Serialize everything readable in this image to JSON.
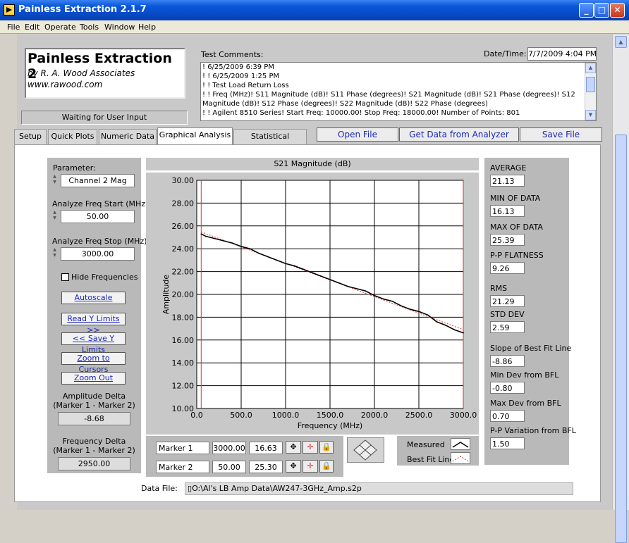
{
  "window": {
    "title": "Painless Extraction 2.1.7"
  },
  "menu": [
    "File",
    "Edit",
    "Operate",
    "Tools",
    "Window",
    "Help"
  ],
  "header": {
    "app_name": "Painless Extraction 2",
    "author": "by R. A. Wood Associates",
    "website": "www.rawood.com",
    "status": "Waiting for User Input"
  },
  "comments": {
    "label": "Test Comments:",
    "date_label": "Date/Time:",
    "date_value": "7/7/2009  4:04 PM",
    "lines": [
      "! 6/25/2009 6:39 PM",
      "! ! 6/25/2009 1:25 PM",
      "! ! Test Load Return Loss",
      "! ! Freq (MHz)! S11 Magnitude (dB)! S11 Phase (degrees)! S21 Magnitude (dB)! S21 Phase (degrees)! S12",
      "Magnitude (dB)! S12 Phase (degrees)! S22 Magnitude (dB)! S22 Phase (degrees)",
      "! ! Agilent 8510 Series! Start Freq: 10000.00! Stop Freq: 18000.00! Number of Points: 801"
    ]
  },
  "tabs": [
    "Setup",
    "Quick Plots",
    "Numeric Data",
    "Graphical Analysis",
    "Statistical Analysis"
  ],
  "actions": {
    "open": "Open File",
    "get_data": "Get Data from Analyzer",
    "save": "Save File"
  },
  "left": {
    "parameter_label": "Parameter:",
    "parameter_value": "Channel 2 Mag",
    "start_label": "Analyze Freq Start (MHz)",
    "start_value": "50.00",
    "stop_label": "Analyze Freq Stop (MHz)",
    "stop_value": "3000.00",
    "hide_freq": "Hide Frequencies",
    "autoscale": "Autoscale",
    "read_y": "Read Y Limits >>",
    "save_y": "<< Save Y Limits",
    "zoom_cursors": "Zoom to Cursors",
    "zoom_out": "Zoom Out",
    "amp_delta_label1": "Amplitude Delta",
    "amp_delta_label2": "(Marker 1 - Marker 2)",
    "amp_delta_value": "-8.68",
    "freq_delta_label1": "Frequency Delta",
    "freq_delta_label2": "(Marker 1 - Marker 2)",
    "freq_delta_value": "2950.00"
  },
  "stats": [
    {
      "label": "AVERAGE",
      "value": "21.13"
    },
    {
      "label": "MIN OF DATA",
      "value": "16.13"
    },
    {
      "label": "MAX OF DATA",
      "value": "25.39"
    },
    {
      "label": "P-P FLATNESS",
      "value": "9.26"
    },
    {
      "label": "RMS",
      "value": "21.29"
    },
    {
      "label": "STD DEV",
      "value": "2.59"
    },
    {
      "label": "Slope of Best Fit Line",
      "value": "-8.86"
    },
    {
      "label": "Min Dev from BFL",
      "value": "-0.80"
    },
    {
      "label": "Max Dev from BFL",
      "value": "0.70"
    },
    {
      "label": "P-P Variation from BFL",
      "value": "1.50"
    }
  ],
  "markers": [
    {
      "name": "Marker 1",
      "freq": "3000.00",
      "amp": "16.63"
    },
    {
      "name": "Marker 2",
      "freq": "50.00",
      "amp": "25.30"
    }
  ],
  "legend": {
    "measured": "Measured",
    "bfl": "Best Fit Line"
  },
  "datafile": {
    "label": "Data File:",
    "path": "O:\\Al's LB Amp Data\\AW247-3GHz_Amp.s2p"
  },
  "colors": {
    "accent": "#1b28b8",
    "cursor": "#e03030",
    "trace": "#000000"
  },
  "chart_data": {
    "type": "line",
    "title": "S21 Magnitude (dB)",
    "xlabel": "Frequency (MHz)",
    "ylabel": "Amplitude",
    "xlim": [
      0,
      3000
    ],
    "ylim": [
      10,
      30
    ],
    "grid": true,
    "x_ticks": [
      "0.0",
      "500.0",
      "1000.0",
      "1500.0",
      "2000.0",
      "2500.0",
      "3000.0"
    ],
    "y_ticks": [
      "10.00",
      "12.00",
      "14.00",
      "16.00",
      "18.00",
      "20.00",
      "22.00",
      "24.00",
      "26.00",
      "28.00",
      "30.00"
    ],
    "cursors_x": [
      50,
      3000
    ],
    "series": [
      {
        "name": "Measured",
        "x": [
          50,
          100,
          200,
          300,
          400,
          500,
          600,
          700,
          800,
          900,
          1000,
          1100,
          1200,
          1300,
          1400,
          1500,
          1600,
          1700,
          1800,
          1900,
          2000,
          2100,
          2200,
          2300,
          2400,
          2500,
          2600,
          2700,
          2800,
          2900,
          3000
        ],
        "y": [
          25.3,
          25.1,
          24.9,
          24.7,
          24.5,
          24.2,
          24.0,
          23.6,
          23.3,
          23.0,
          22.7,
          22.5,
          22.2,
          21.9,
          21.6,
          21.3,
          21.0,
          20.7,
          20.5,
          20.3,
          19.9,
          19.6,
          19.4,
          19.0,
          18.7,
          18.5,
          18.2,
          17.6,
          17.3,
          16.9,
          16.63
        ]
      }
    ]
  }
}
